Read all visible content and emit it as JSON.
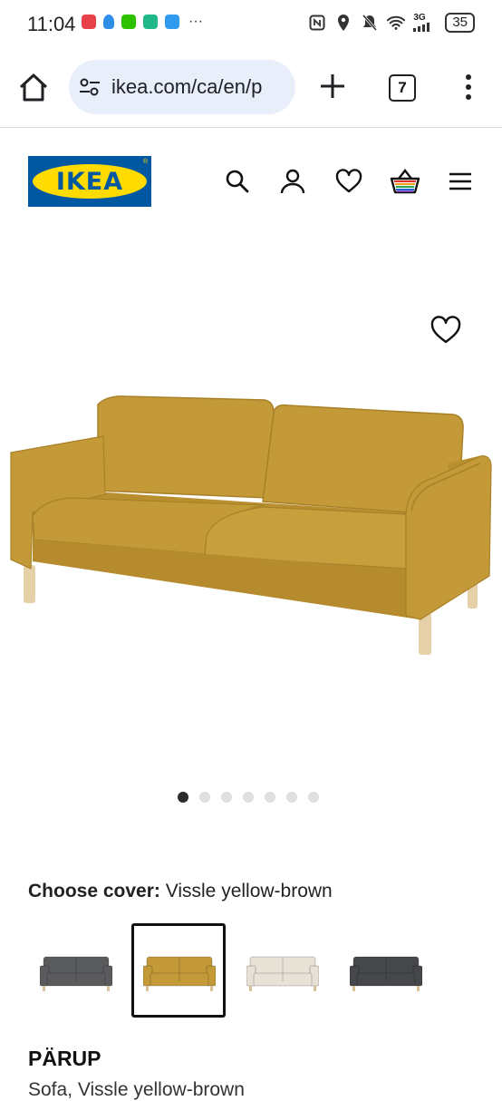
{
  "status_bar": {
    "time": "11:04",
    "network_label": "3G",
    "battery": "35"
  },
  "browser": {
    "url": "ikea.com/ca/en/p",
    "tab_count": "7"
  },
  "header": {
    "logo_text": "IKEA",
    "logo_trademark": "®"
  },
  "gallery": {
    "image_count": 7,
    "active_index": 0,
    "colors": {
      "sofa": "#c49a38",
      "sofa_shade": "#a88128",
      "legs": "#e6d0a8"
    }
  },
  "cover": {
    "label": "Choose cover:",
    "value": "Vissle yellow-brown",
    "options": [
      {
        "name": "dark-gray",
        "color": "#5a5b5d"
      },
      {
        "name": "yellow-brown",
        "color": "#c49a38"
      },
      {
        "name": "beige",
        "color": "#e8e2d6"
      },
      {
        "name": "charcoal",
        "color": "#45474a"
      }
    ],
    "selected_index": 1
  },
  "product": {
    "name": "PÄRUP",
    "description": "Sofa, Vissle yellow-brown"
  }
}
